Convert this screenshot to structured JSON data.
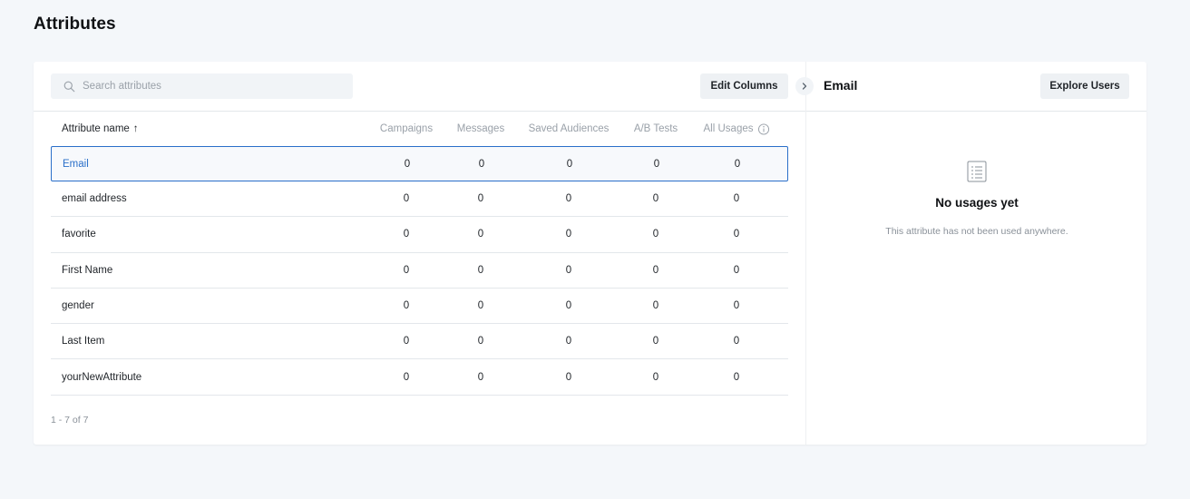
{
  "page": {
    "title": "Attributes"
  },
  "toolbar": {
    "search_placeholder": "Search attributes",
    "search_value": "",
    "edit_columns_label": "Edit Columns"
  },
  "table": {
    "columns": {
      "name": "Attribute name",
      "sort_indicator": "↑",
      "campaigns": "Campaigns",
      "messages": "Messages",
      "saved_audiences": "Saved Audiences",
      "ab_tests": "A/B Tests",
      "all_usages": "All Usages"
    },
    "rows": [
      {
        "name": "Email",
        "campaigns": "0",
        "messages": "0",
        "saved_audiences": "0",
        "ab_tests": "0",
        "all_usages": "0",
        "selected": true
      },
      {
        "name": "email address",
        "campaigns": "0",
        "messages": "0",
        "saved_audiences": "0",
        "ab_tests": "0",
        "all_usages": "0"
      },
      {
        "name": "favorite",
        "campaigns": "0",
        "messages": "0",
        "saved_audiences": "0",
        "ab_tests": "0",
        "all_usages": "0"
      },
      {
        "name": "First Name",
        "campaigns": "0",
        "messages": "0",
        "saved_audiences": "0",
        "ab_tests": "0",
        "all_usages": "0"
      },
      {
        "name": "gender",
        "campaigns": "0",
        "messages": "0",
        "saved_audiences": "0",
        "ab_tests": "0",
        "all_usages": "0"
      },
      {
        "name": "Last Item",
        "campaigns": "0",
        "messages": "0",
        "saved_audiences": "0",
        "ab_tests": "0",
        "all_usages": "0"
      },
      {
        "name": "yourNewAttribute",
        "campaigns": "0",
        "messages": "0",
        "saved_audiences": "0",
        "ab_tests": "0",
        "all_usages": "0"
      }
    ],
    "pagination": "1 - 7 of 7"
  },
  "detail": {
    "title": "Email",
    "explore_users_label": "Explore Users",
    "empty_title": "No usages yet",
    "empty_subtitle": "This attribute has not been used anywhere."
  },
  "icons": {
    "search": "search-icon",
    "sort": "sort-ascending-icon",
    "info": "info-icon",
    "collapse": "chevron-right-icon",
    "empty": "list-document-icon"
  },
  "colors": {
    "accent": "#2a6fc9",
    "background": "#f4f7fa",
    "button_bg": "#eef1f4",
    "muted_text": "#9aa1a9"
  }
}
